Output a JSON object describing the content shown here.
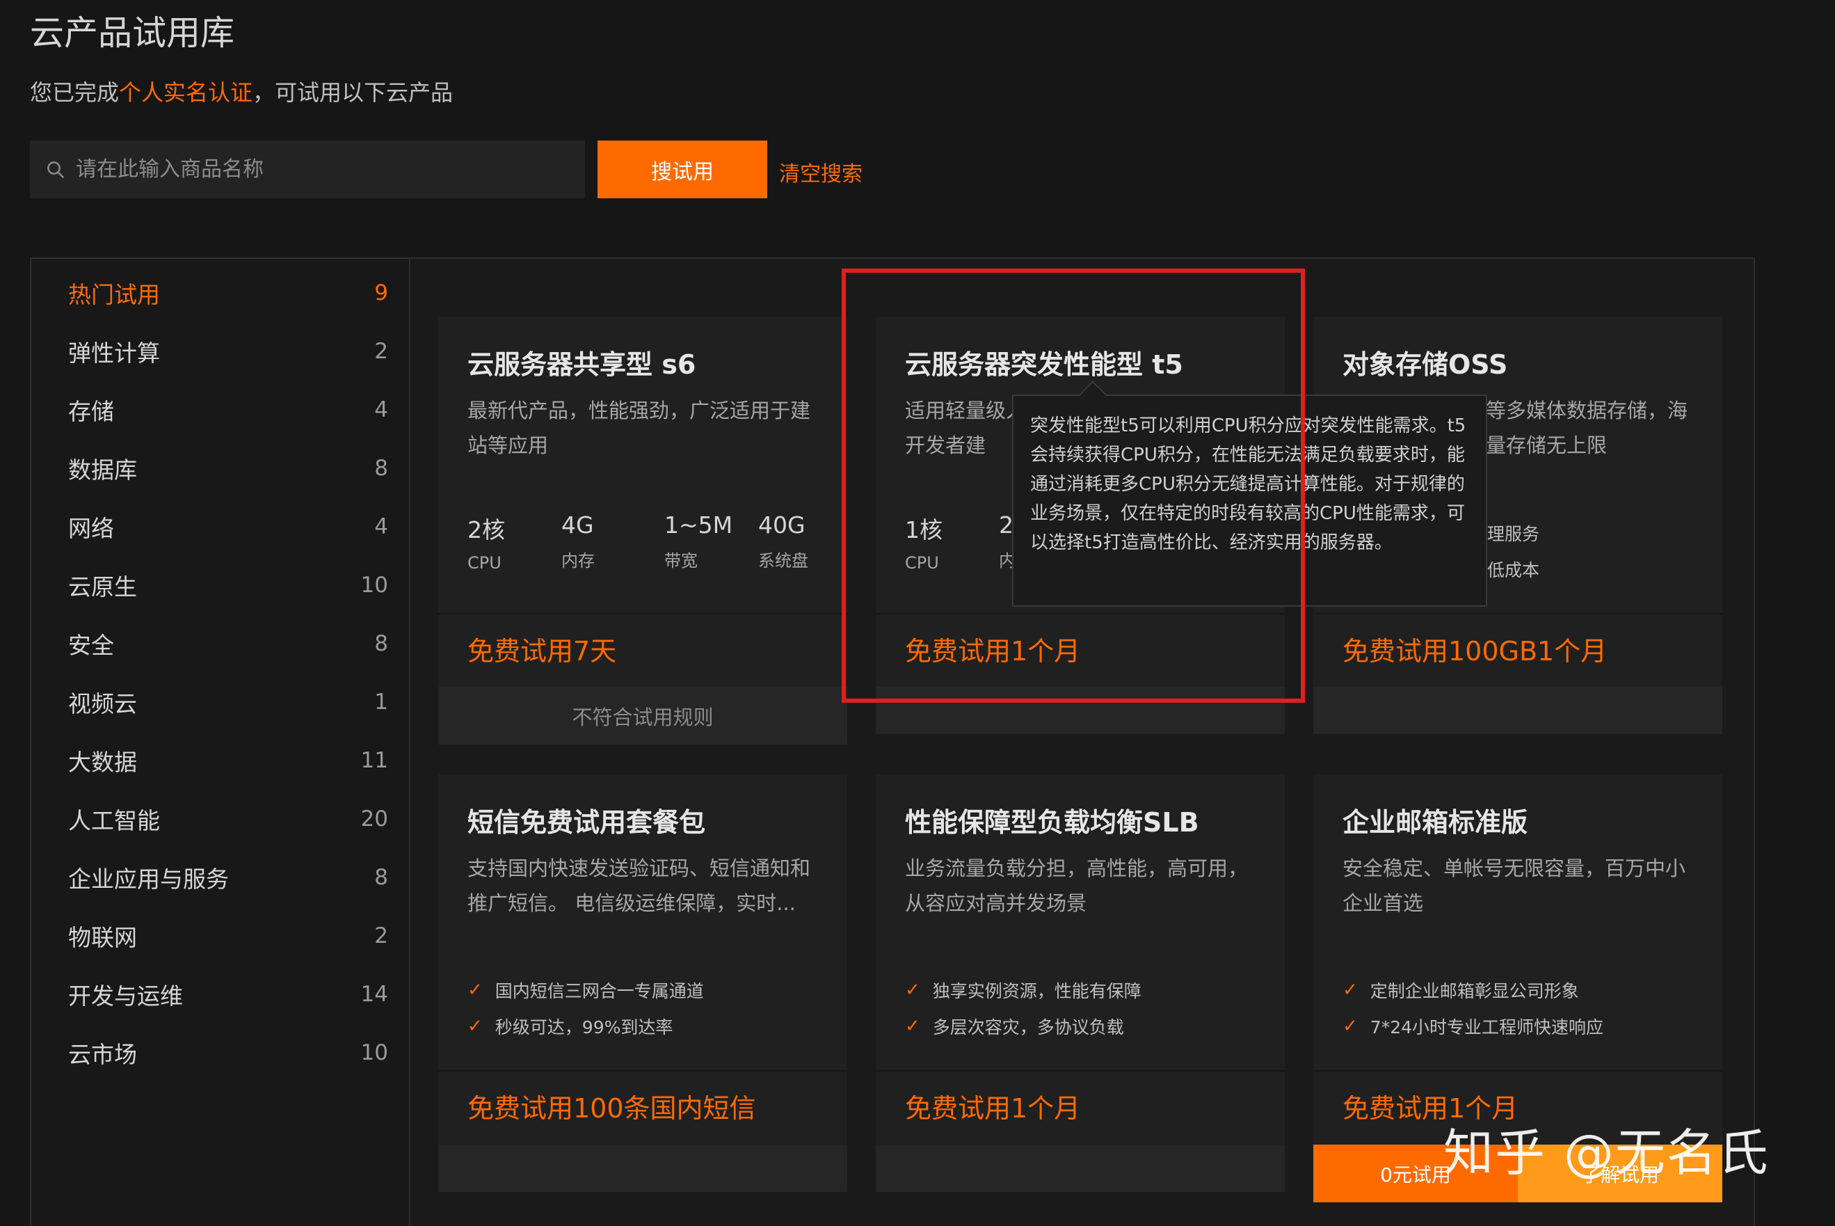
{
  "header": {
    "title": "云产品试用库",
    "subtitle_prefix": "您已完成",
    "subtitle_highlight": "个人实名认证",
    "subtitle_suffix": "，可试用以下云产品"
  },
  "search": {
    "placeholder": "请在此输入商品名称",
    "button_label": "搜试用",
    "clear_label": "清空搜索"
  },
  "sidebar": {
    "items": [
      {
        "label": "热门试用",
        "count": "9",
        "active": true
      },
      {
        "label": "弹性计算",
        "count": "2"
      },
      {
        "label": "存储",
        "count": "4"
      },
      {
        "label": "数据库",
        "count": "8"
      },
      {
        "label": "网络",
        "count": "4"
      },
      {
        "label": "云原生",
        "count": "10"
      },
      {
        "label": "安全",
        "count": "8"
      },
      {
        "label": "视频云",
        "count": "1"
      },
      {
        "label": "大数据",
        "count": "11"
      },
      {
        "label": "人工智能",
        "count": "20"
      },
      {
        "label": "企业应用与服务",
        "count": "8"
      },
      {
        "label": "物联网",
        "count": "2"
      },
      {
        "label": "开发与运维",
        "count": "14"
      },
      {
        "label": "云市场",
        "count": "10"
      }
    ]
  },
  "cards": [
    {
      "title": "云服务器共享型 s6",
      "desc": "最新代产品，性能强劲，广泛适用于建站等应用",
      "specs": [
        {
          "value": "2核",
          "unit": "CPU"
        },
        {
          "value": "4G",
          "unit": "内存"
        },
        {
          "value": "1~5M",
          "unit": "带宽"
        },
        {
          "value": "40G",
          "unit": "系统盘"
        }
      ],
      "offer": "免费试用7天",
      "footer": "不符合试用规则"
    },
    {
      "title": "云服务器突发性能型 t5",
      "desc": "适用轻量级人开发者建",
      "specs": [
        {
          "value": "1核",
          "unit": "CPU"
        },
        {
          "value": "2",
          "unit": "内"
        }
      ],
      "offer": "免费试用1个月",
      "footer": ""
    },
    {
      "title": "对象存储OSS",
      "desc": "等多媒体数据存储，海量存储无上限",
      "features": [
        "理服务",
        "低成本"
      ],
      "offer": "免费试用100GB1个月",
      "footer": ""
    },
    {
      "title": "短信免费试用套餐包",
      "desc": "支持国内快速发送验证码、短信通知和推广短信。 电信级运维保障，实时...",
      "features": [
        "国内短信三网合一专属通道",
        "秒级可达，99%到达率"
      ],
      "offer": "免费试用100条国内短信",
      "footer": ""
    },
    {
      "title": "性能保障型负载均衡SLB",
      "desc": "业务流量负载分担，高性能，高可用，从容应对高并发场景",
      "features": [
        "独享实例资源，性能有保障",
        "多层次容灾，多协议负载"
      ],
      "offer": "免费试用1个月",
      "footer": ""
    },
    {
      "title": "企业邮箱标准版",
      "desc": "安全稳定、单帐号无限容量，百万中小企业首选",
      "features": [
        "定制企业邮箱彰显公司形象",
        "7*24小时专业工程师快速响应"
      ],
      "offer": "免费试用1个月",
      "buttons": [
        "0元试用",
        "了解试用"
      ]
    }
  ],
  "tooltip": {
    "text": "突发性能型t5可以利用CPU积分应对突发性能需求。t5会持续获得CPU积分，在性能无法满足负载要求时，能通过消耗更多CPU积分无缝提高计算性能。对于规律的业务场景，仅在特定的时段有较高的CPU性能需求，可以选择t5打造高性价比、经济实用的服务器。"
  },
  "watermark": "知乎 @无名氏",
  "colors": {
    "accent": "#ff6a00",
    "highlight_box": "#e0201f"
  }
}
